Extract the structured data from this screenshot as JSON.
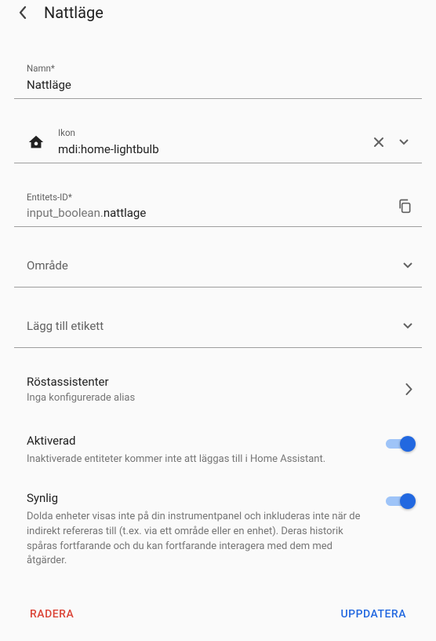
{
  "header": {
    "title": "Nattläge"
  },
  "name": {
    "label": "Namn*",
    "value": "Nattläge"
  },
  "icon": {
    "label": "Ikon",
    "value": "mdi:home-lightbulb"
  },
  "entity": {
    "label": "Entitets-ID*",
    "prefix": "input_boolean.",
    "suffix": "nattlage"
  },
  "area": {
    "label": "Område"
  },
  "add_label": {
    "label": "Lägg till etikett"
  },
  "voice": {
    "title": "Röstassistenter",
    "subtitle": "Inga konfigurerade alias"
  },
  "enabled": {
    "title": "Aktiverad",
    "desc": "Inaktiverade entiteter kommer inte att läggas till i Home Assistant."
  },
  "visible": {
    "title": "Synlig",
    "desc": "Dolda enheter visas inte på din instrumentpanel och inkluderas inte när de indirekt refereras till (t.ex. via ett område eller en enhet). Deras historik spåras fortfarande och du kan fortfarande interagera med dem med åtgärder."
  },
  "footer": {
    "delete": "RADERA",
    "update": "UPPDATERA"
  }
}
